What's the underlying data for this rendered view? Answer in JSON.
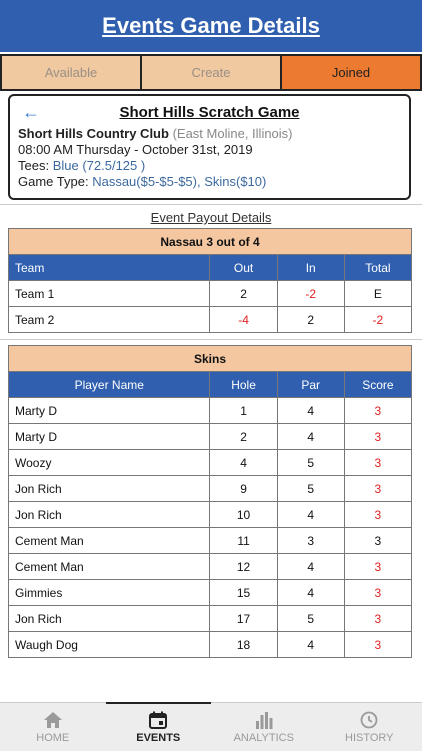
{
  "header": {
    "title": "Events Game Details"
  },
  "tabs": [
    {
      "label": "Available"
    },
    {
      "label": "Create"
    },
    {
      "label": "Joined"
    }
  ],
  "game": {
    "title": "Short Hills Scratch Game",
    "club": "Short Hills Country Club",
    "location": "(East Moline, Illinois)",
    "datetime": "08:00 AM Thursday - October 31st, 2019",
    "tees_label": "Tees:",
    "tees_value": "Blue (72.5/125 )",
    "type_label": "Game Type:",
    "type_value": "Nassau($5-$5-$5), Skins($10)"
  },
  "payout_title": "Event Payout Details",
  "nassau": {
    "caption": "Nassau 3 out of 4",
    "headers": [
      "Team",
      "Out",
      "In",
      "Total"
    ],
    "rows": [
      [
        "Team 1",
        "2",
        "-2",
        "E"
      ],
      [
        "Team 2",
        "-4",
        "2",
        "-2"
      ]
    ]
  },
  "skins": {
    "caption": "Skins",
    "headers": [
      "Player Name",
      "Hole",
      "Par",
      "Score"
    ],
    "rows": [
      [
        "Marty D",
        "1",
        "4",
        "3"
      ],
      [
        "Marty D",
        "2",
        "4",
        "3"
      ],
      [
        "Woozy",
        "4",
        "5",
        "3"
      ],
      [
        "Jon Rich",
        "9",
        "5",
        "3"
      ],
      [
        "Jon Rich",
        "10",
        "4",
        "3"
      ],
      [
        "Cement Man",
        "11",
        "3",
        "3"
      ],
      [
        "Cement Man",
        "12",
        "4",
        "3"
      ],
      [
        "Gimmies",
        "15",
        "4",
        "3"
      ],
      [
        "Jon Rich",
        "17",
        "5",
        "3"
      ],
      [
        "Waugh Dog",
        "18",
        "4",
        "3"
      ]
    ]
  },
  "nav": [
    {
      "label": "HOME",
      "icon": "home-icon"
    },
    {
      "label": "EVENTS",
      "icon": "calendar-icon"
    },
    {
      "label": "ANALYTICS",
      "icon": "bar-chart-icon"
    },
    {
      "label": "HISTORY",
      "icon": "history-icon"
    }
  ],
  "colors": {
    "header": "#2f5fae",
    "tab_active": "#ec7a31",
    "tab_inactive": "#f0c9a0",
    "negative": "#e02020"
  }
}
